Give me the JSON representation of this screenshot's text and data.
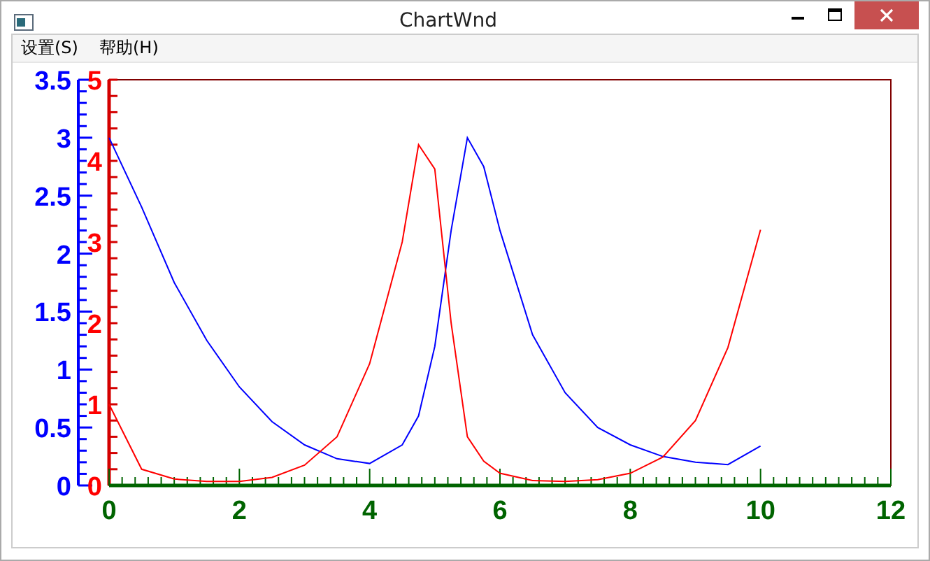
{
  "window": {
    "title": "ChartWnd"
  },
  "menu": [
    {
      "label": "设置(S)"
    },
    {
      "label": "帮助(H)"
    }
  ],
  "chart_data": {
    "type": "line",
    "x": [
      0,
      0.5,
      1,
      1.5,
      2,
      2.5,
      3,
      3.5,
      4,
      4.5,
      4.75,
      5,
      5.25,
      5.5,
      5.75,
      6,
      6.5,
      7,
      7.5,
      8,
      8.5,
      9,
      9.5,
      10
    ],
    "xlim": [
      0,
      12
    ],
    "ylim": [
      0,
      3.5
    ],
    "y2lim": [
      0,
      5
    ],
    "xticks": [
      0,
      2,
      4,
      6,
      8,
      10,
      12
    ],
    "yticks": [
      0,
      0.5,
      1,
      1.5,
      2,
      2.5,
      3,
      3.5
    ],
    "y2ticks": [
      0,
      1,
      2,
      3,
      4,
      5
    ],
    "series": [
      {
        "color": "#0000ff",
        "axis": "y",
        "values": [
          3.0,
          2.4,
          1.75,
          1.25,
          0.85,
          0.55,
          0.35,
          0.23,
          0.19,
          0.35,
          0.6,
          1.2,
          2.2,
          3.0,
          2.75,
          2.2,
          1.3,
          0.8,
          0.5,
          0.35,
          0.25,
          0.2,
          0.18,
          0.34
        ]
      },
      {
        "color": "#ff0000",
        "axis": "y2",
        "values": [
          1.0,
          0.2,
          0.08,
          0.05,
          0.05,
          0.1,
          0.25,
          0.6,
          1.5,
          3.0,
          4.2,
          3.9,
          2.0,
          0.6,
          0.3,
          0.15,
          0.06,
          0.05,
          0.07,
          0.15,
          0.35,
          0.8,
          1.7,
          3.15
        ]
      }
    ]
  }
}
